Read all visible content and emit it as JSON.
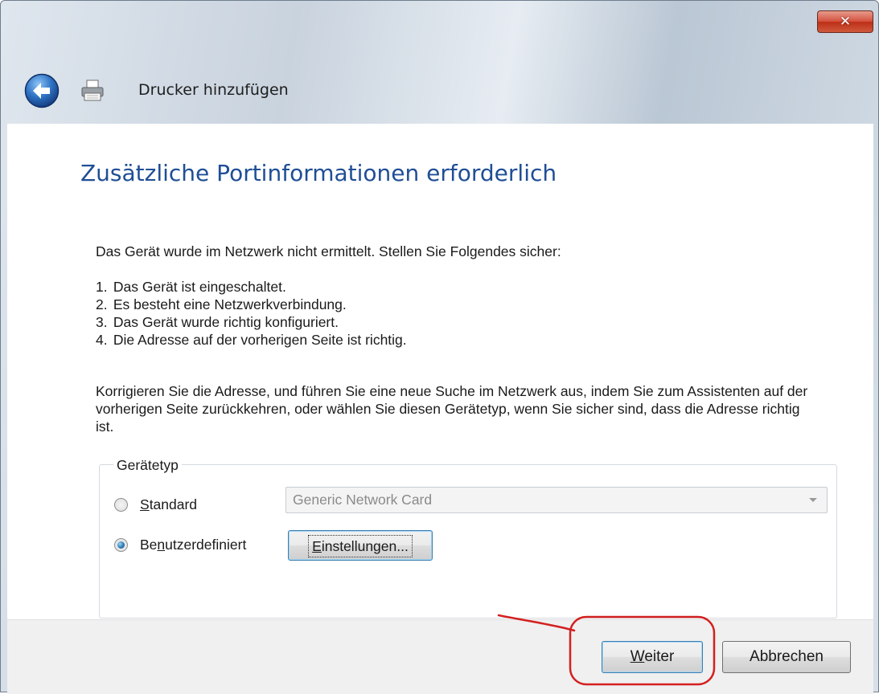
{
  "window": {
    "title": "Drucker hinzufügen",
    "close_label": "✕"
  },
  "page": {
    "heading": "Zusätzliche Portinformationen erforderlich",
    "intro": "Das Gerät wurde im Netzwerk nicht ermittelt. Stellen Sie Folgendes sicher:",
    "checklist": [
      {
        "num": "1.",
        "text": "Das Gerät ist eingeschaltet."
      },
      {
        "num": "2.",
        "text": "Es besteht eine Netzwerkverbindung."
      },
      {
        "num": "3.",
        "text": "Das Gerät wurde richtig konfiguriert."
      },
      {
        "num": "4.",
        "text": "Die Adresse auf der vorherigen Seite ist richtig."
      }
    ],
    "paragraph": "Korrigieren Sie die Adresse, und führen Sie eine neue Suche im Netzwerk aus, indem Sie zum Assistenten auf der vorherigen Seite zurückkehren, oder wählen Sie diesen Gerätetyp, wenn Sie sicher sind, dass die Adresse richtig ist."
  },
  "device_type": {
    "legend": "Gerätetyp",
    "standard": {
      "mnemonic": "S",
      "rest": "tandard",
      "checked": false
    },
    "custom": {
      "before": "Be",
      "mnemonic": "n",
      "after": "utzerdefiniert",
      "checked": true
    },
    "dropdown_value": "Generic Network Card",
    "settings_button": {
      "mnemonic": "E",
      "rest": "instellungen..."
    }
  },
  "footer": {
    "next_button": {
      "mnemonic": "W",
      "rest": "eiter"
    },
    "cancel_button": "Abbrechen"
  },
  "colors": {
    "heading": "#1f4e96",
    "annotation": "#d42020",
    "close_button": "#c8412a"
  },
  "icons": [
    "back-arrow-icon",
    "printer-icon",
    "close-icon",
    "chevron-down-icon"
  ]
}
